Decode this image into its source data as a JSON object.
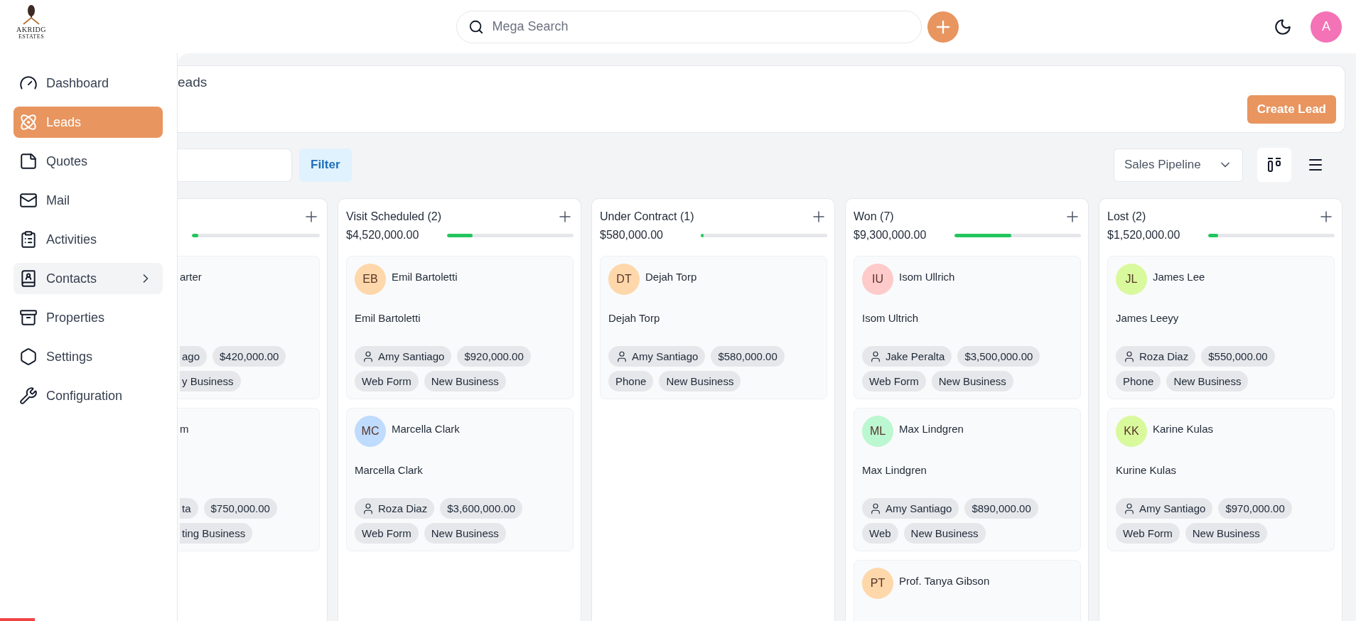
{
  "topbar": {
    "logo": {
      "name": "AKRIDG",
      "tagline": "ESTATES"
    },
    "search": {
      "placeholder": "Mega Search"
    },
    "avatar": "A"
  },
  "sidebar": {
    "items": [
      {
        "label": "Dashboard",
        "kind": "link",
        "selected": false,
        "hovered": false
      },
      {
        "label": "Leads",
        "kind": "link",
        "selected": true,
        "hovered": false
      },
      {
        "label": "Quotes",
        "kind": "link",
        "selected": false,
        "hovered": false
      },
      {
        "label": "Mail",
        "kind": "link",
        "selected": false,
        "hovered": false
      },
      {
        "label": "Activities",
        "kind": "link",
        "selected": false,
        "hovered": false
      },
      {
        "label": "Contacts",
        "kind": "submenu",
        "selected": false,
        "hovered": true
      },
      {
        "label": "Properties",
        "kind": "link",
        "selected": false,
        "hovered": false
      },
      {
        "label": "Settings",
        "kind": "link",
        "selected": false,
        "hovered": false
      },
      {
        "label": "Configuration",
        "kind": "link",
        "selected": false,
        "hovered": false
      }
    ]
  },
  "page": {
    "title": "eads",
    "action": "Create Lead"
  },
  "toolbar": {
    "filter": "Filter",
    "pipeline": "Sales Pipeline",
    "views": [
      {
        "kind": "kanban",
        "selected": true
      },
      {
        "kind": "list",
        "selected": false
      }
    ]
  },
  "columns": [
    {
      "level": 0.05,
      "cards": [
        {
          "name": "arter",
          "chips": [
            {
              "kind": "plain",
              "label": "ago"
            },
            {
              "kind": "plain",
              "label": "$420,000.00"
            }
          ],
          "tags": [
            "y Business"
          ]
        },
        {
          "name": "m",
          "chips": [
            {
              "kind": "plain",
              "label": "ta"
            },
            {
              "kind": "plain",
              "label": "$750,000.00"
            }
          ],
          "tags": [
            "ting Business"
          ]
        }
      ]
    },
    {
      "title": "Visit Scheduled (2)",
      "amount": "$4,520,000.00",
      "level": 0.2,
      "cards": [
        {
          "initials": "EB",
          "color": "#fed7aa",
          "name": "Emil Bartoletti",
          "title": "Emil Bartoletti",
          "chips": [
            {
              "kind": "agent",
              "label": "Amy Santiago"
            },
            {
              "kind": "plain",
              "label": "$920,000.00"
            }
          ],
          "tags": [
            "Web Form",
            "New Business"
          ]
        },
        {
          "initials": "MC",
          "color": "#bfdbfe",
          "name": "Marcella Clark",
          "title": "Marcella Clark",
          "chips": [
            {
              "kind": "agent",
              "label": "Roza Diaz"
            },
            {
              "kind": "plain",
              "label": "$3,600,000.00"
            }
          ],
          "tags": [
            "Web Form",
            "New Business"
          ]
        }
      ]
    },
    {
      "title": "Under Contract (1)",
      "amount": "$580,000.00",
      "level": 0.02,
      "cards": [
        {
          "initials": "DT",
          "color": "#fed7aa",
          "name": "Dejah Torp",
          "title": "Dejah Torp",
          "chips": [
            {
              "kind": "agent",
              "label": "Amy Santiago"
            },
            {
              "kind": "plain",
              "label": "$580,000.00"
            }
          ],
          "tags": [
            "Phone",
            "New Business"
          ]
        }
      ]
    },
    {
      "title": "Won (7)",
      "amount": "$9,300,000.00",
      "level": 0.45,
      "cards": [
        {
          "initials": "IU",
          "color": "#fecaca",
          "name": "Isom Ullrich",
          "title": "Isom Ultrich",
          "chips": [
            {
              "kind": "agent",
              "label": "Jake Peralta"
            },
            {
              "kind": "plain",
              "label": "$3,500,000.00"
            }
          ],
          "tags": [
            "Web Form",
            "New Business"
          ]
        },
        {
          "initials": "ML",
          "color": "#bbf7d0",
          "name": "Max Lindgren",
          "title": "Max Lindgren",
          "chips": [
            {
              "kind": "agent",
              "label": "Amy Santiago"
            },
            {
              "kind": "plain",
              "label": "$890,000.00"
            }
          ],
          "tags": [
            "Web",
            "New Business"
          ]
        },
        {
          "initials": "PT",
          "color": "#fed7aa",
          "name": "Prof. Tanya Gibson"
        }
      ]
    },
    {
      "title": "Lost (2)",
      "amount": "$1,520,000.00",
      "level": 0.08,
      "cards": [
        {
          "initials": "JL",
          "color": "#d9f99d",
          "name": "James Lee",
          "title": "James Leeyy",
          "chips": [
            {
              "kind": "agent",
              "label": "Roza Diaz"
            },
            {
              "kind": "plain",
              "label": "$550,000.00"
            }
          ],
          "tags": [
            "Phone",
            "New Business"
          ]
        },
        {
          "initials": "KK",
          "color": "#d9f99d",
          "name": "Karine Kulas",
          "title": "Kurine Kulas",
          "chips": [
            {
              "kind": "agent",
              "label": "Amy Santiago"
            },
            {
              "kind": "plain",
              "label": "$970,000.00"
            }
          ],
          "tags": [
            "Web Form",
            "New Business"
          ]
        }
      ]
    }
  ]
}
